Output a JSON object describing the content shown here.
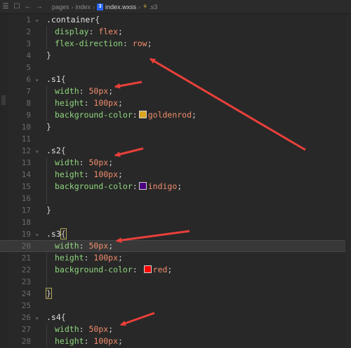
{
  "toolbar": {
    "breadcrumb": [
      "pages",
      "index",
      "index.wxss",
      ".s3"
    ],
    "file_icon": "css-file-icon",
    "symbol_icon": "symbol-class-icon"
  },
  "colors": {
    "goldenrod": "#daa520",
    "indigo": "#4b0082",
    "red": "#ff0000",
    "annotation_arrow": "#e8403a"
  },
  "editor": {
    "highlighted_line": 20,
    "lines": [
      {
        "n": "1",
        "t": ".container{"
      },
      {
        "n": "2",
        "t": "  display: flex;"
      },
      {
        "n": "3",
        "t": "  flex-direction: row;"
      },
      {
        "n": "4",
        "t": "}"
      },
      {
        "n": "5",
        "t": ""
      },
      {
        "n": "6",
        "t": ".s1{"
      },
      {
        "n": "7",
        "t": "  width: 50px;"
      },
      {
        "n": "8",
        "t": "  height: 100px;"
      },
      {
        "n": "9",
        "t": "  background-color:goldenrod;"
      },
      {
        "n": "10",
        "t": "}"
      },
      {
        "n": "11",
        "t": ""
      },
      {
        "n": "12",
        "t": ".s2{"
      },
      {
        "n": "13",
        "t": "  width: 50px;"
      },
      {
        "n": "14",
        "t": "  height: 100px;"
      },
      {
        "n": "15",
        "t": "  background-color:indigo;"
      },
      {
        "n": "16",
        "t": ""
      },
      {
        "n": "17",
        "t": "}"
      },
      {
        "n": "18",
        "t": ""
      },
      {
        "n": "19",
        "t": ".s3{"
      },
      {
        "n": "20",
        "t": "  width: 50px;"
      },
      {
        "n": "21",
        "t": "  height: 100px;"
      },
      {
        "n": "22",
        "t": "  background-color: red;"
      },
      {
        "n": "23",
        "t": ""
      },
      {
        "n": "24",
        "t": "}"
      },
      {
        "n": "25",
        "t": ""
      },
      {
        "n": "26",
        "t": ".s4{"
      },
      {
        "n": "27",
        "t": "  width: 50px;"
      },
      {
        "n": "28",
        "t": "  height: 100px;"
      }
    ]
  }
}
